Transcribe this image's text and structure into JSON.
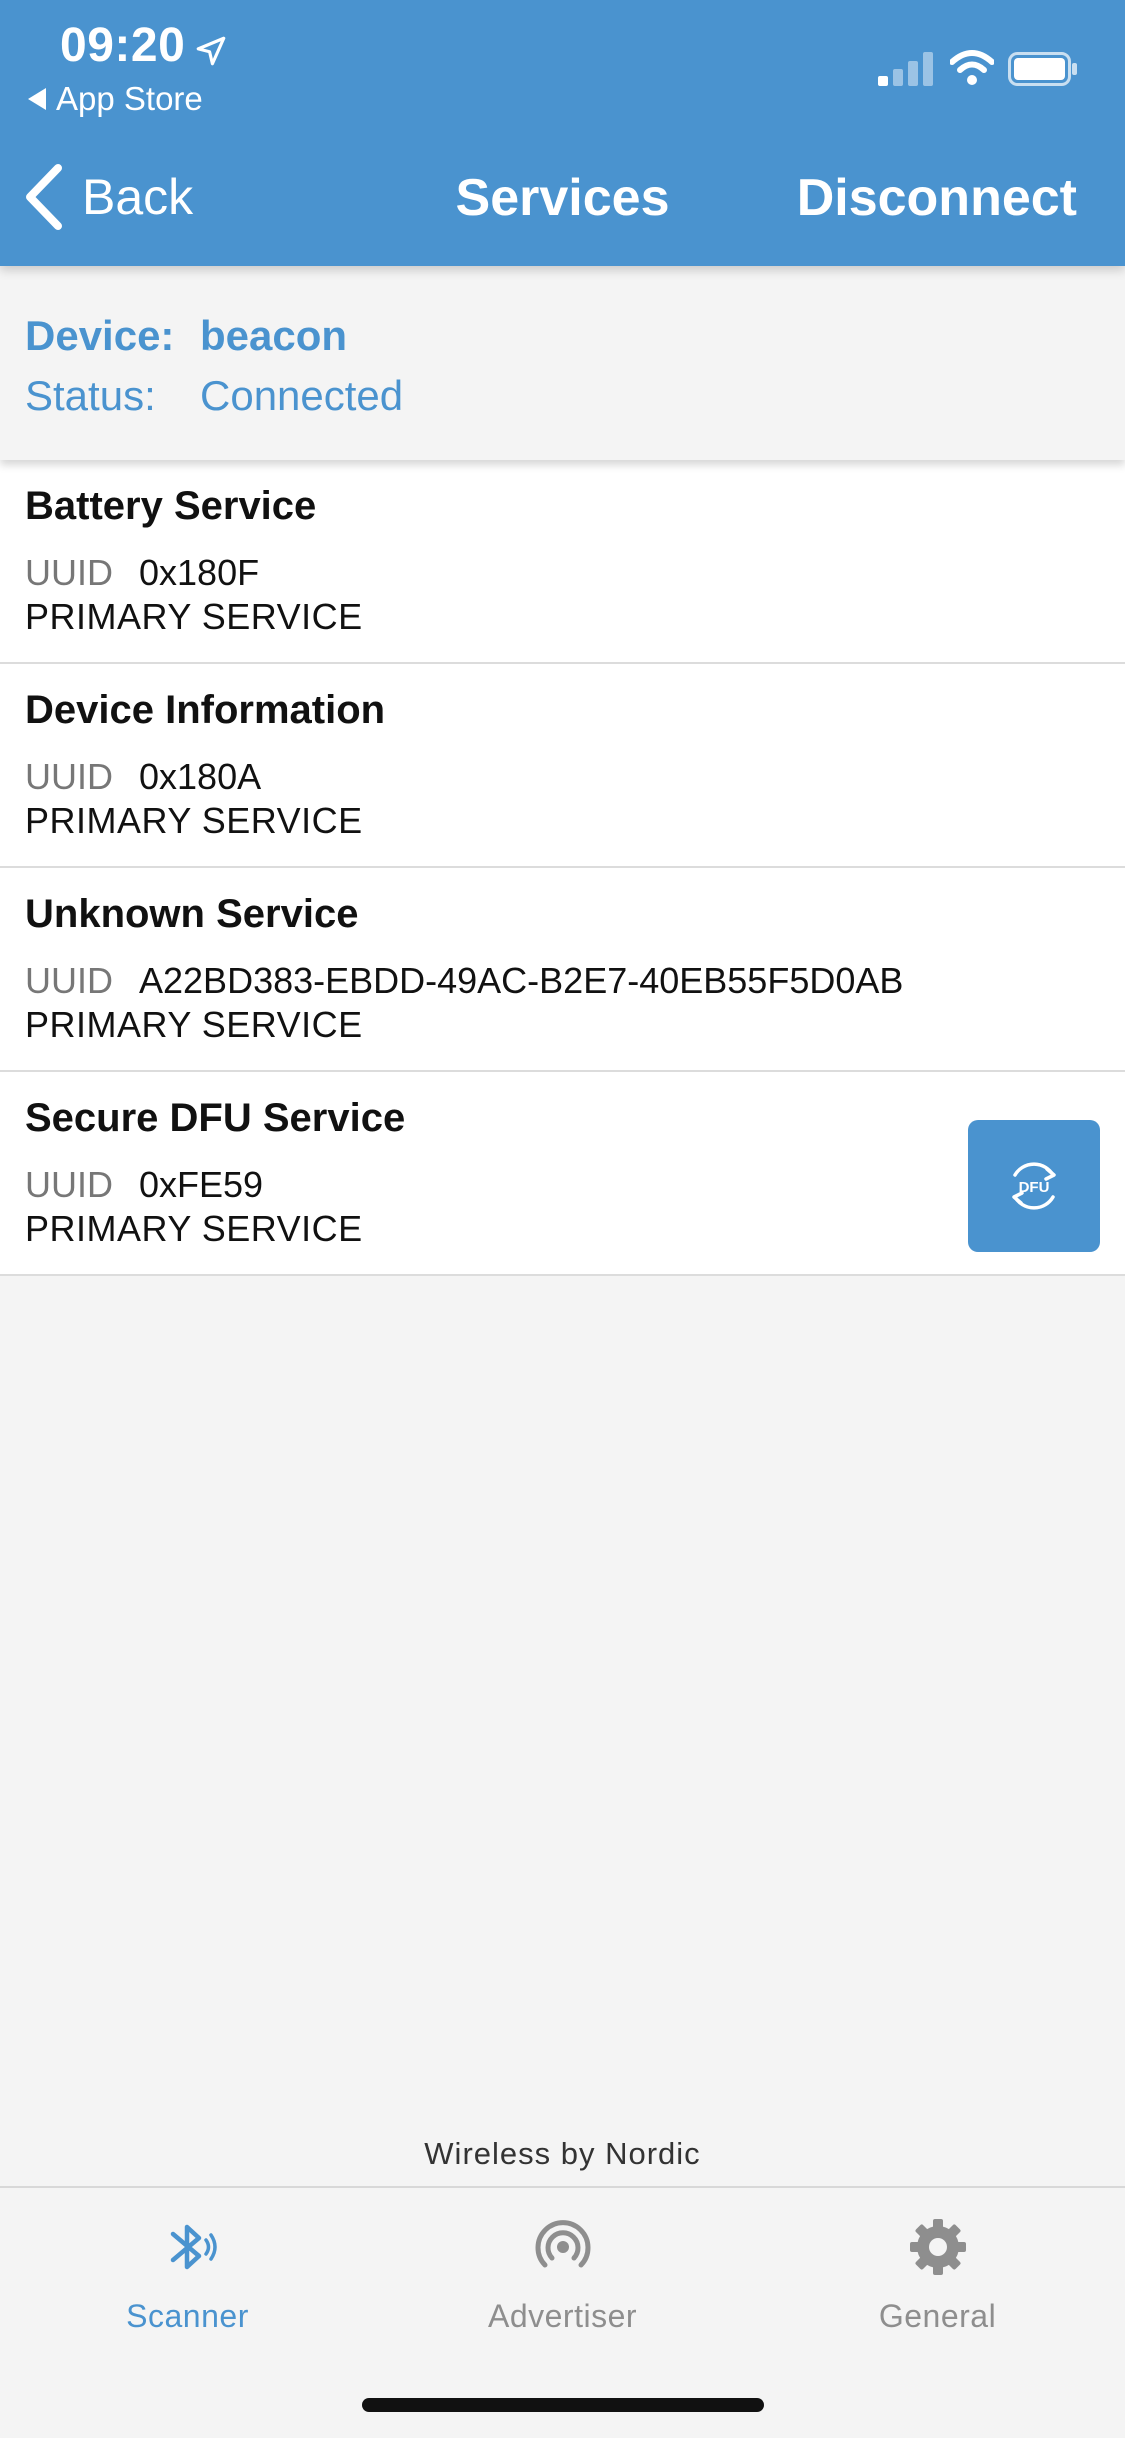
{
  "status_bar": {
    "time": "09:20",
    "back_app": "App Store"
  },
  "nav": {
    "back_label": "Back",
    "title": "Services",
    "disconnect_label": "Disconnect"
  },
  "device": {
    "device_label": "Device:",
    "device_value": "beacon",
    "status_label": "Status:",
    "status_value": "Connected"
  },
  "services": [
    {
      "name": "Battery Service",
      "uuid_label": "UUID",
      "uuid": "0x180F",
      "type": "PRIMARY SERVICE"
    },
    {
      "name": "Device Information",
      "uuid_label": "UUID",
      "uuid": "0x180A",
      "type": "PRIMARY SERVICE"
    },
    {
      "name": "Unknown Service",
      "uuid_label": "UUID",
      "uuid": "A22BD383-EBDD-49AC-B2E7-40EB55F5D0AB",
      "type": "PRIMARY SERVICE"
    },
    {
      "name": "Secure DFU Service",
      "uuid_label": "UUID",
      "uuid": "0xFE59",
      "type": "PRIMARY SERVICE",
      "action_icon": "dfu-icon",
      "action_text": "DFU"
    }
  ],
  "footer": {
    "brand": "Wireless by Nordic"
  },
  "tabs": [
    {
      "label": "Scanner",
      "icon": "bluetooth-icon",
      "active": true
    },
    {
      "label": "Advertiser",
      "icon": "broadcast-icon",
      "active": false
    },
    {
      "label": "General",
      "icon": "gear-icon",
      "active": false
    }
  ],
  "colors": {
    "accent": "#4a93cf",
    "inactive_tab": "#8e8e8e",
    "background": "#f4f4f4"
  }
}
